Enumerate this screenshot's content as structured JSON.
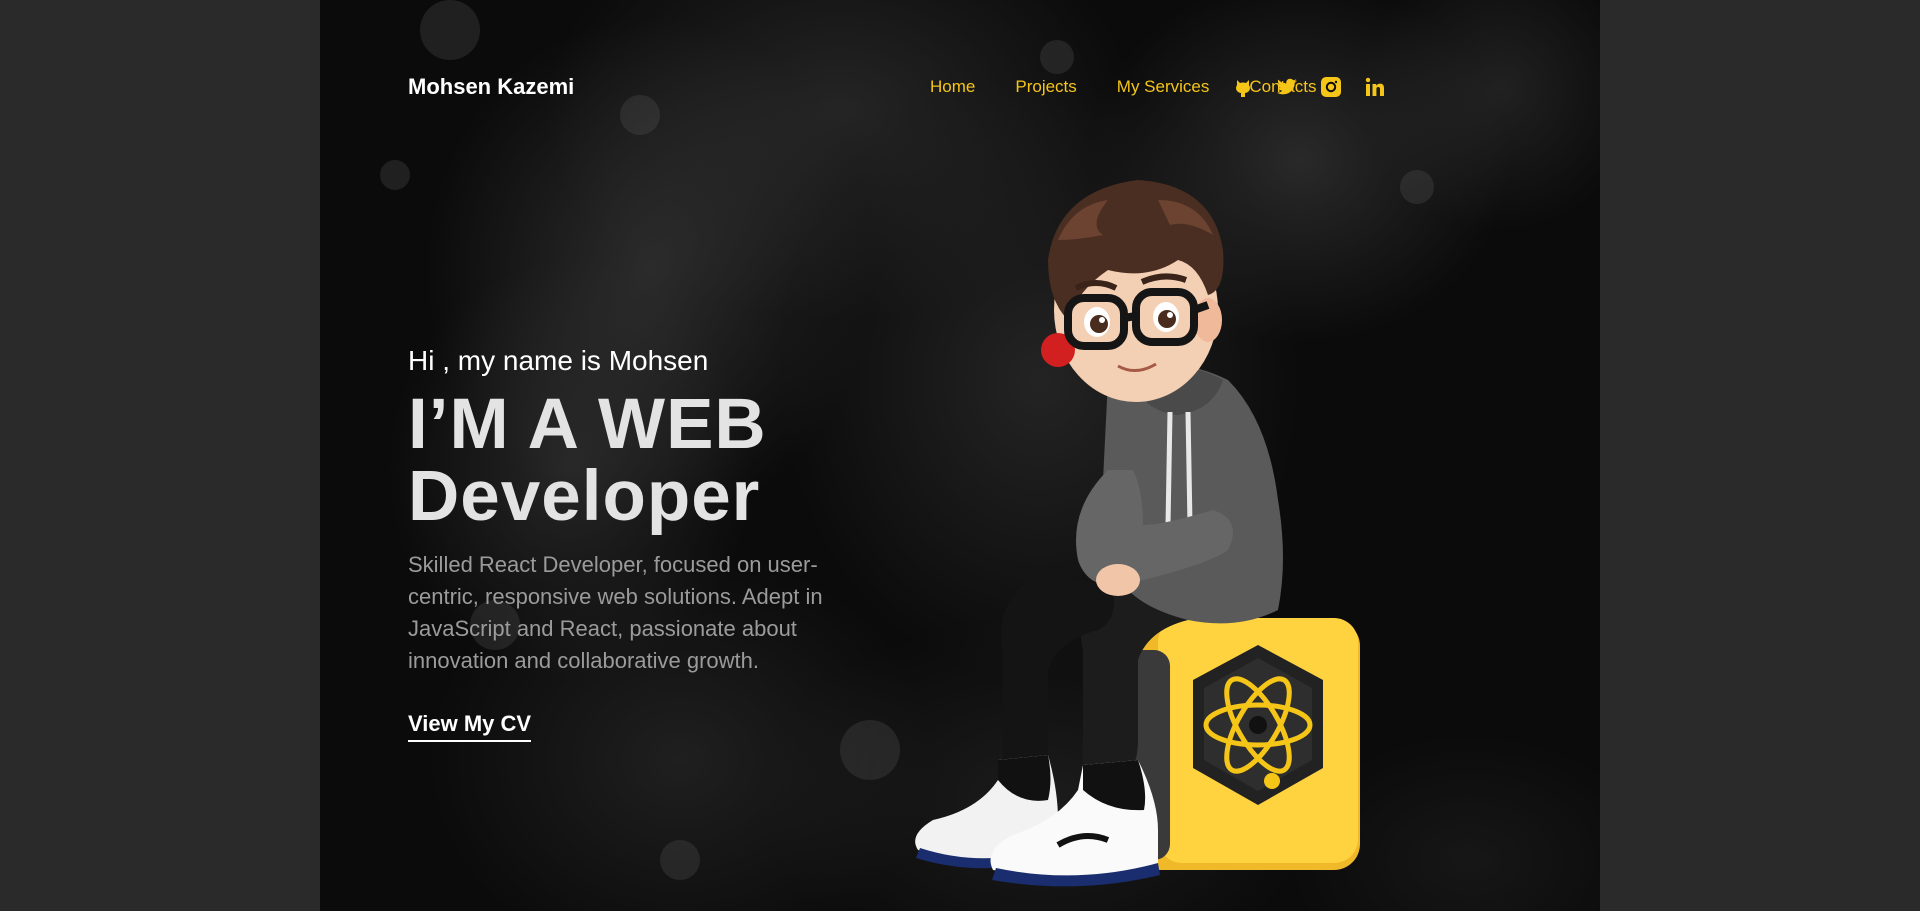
{
  "header": {
    "logo": "Mohsen Kazemi",
    "nav": [
      "Home",
      "Projects",
      "My Services",
      "Contacts"
    ],
    "socials": [
      "github-icon",
      "twitter-icon",
      "instagram-icon",
      "linkedin-icon"
    ]
  },
  "hero": {
    "greeting": "Hi , my name is Mohsen",
    "headline_line1": "I’M A WEB",
    "headline_line2": "Developer",
    "description": "Skilled React Developer, focused on user-centric, responsive web solutions. Adept in JavaScript and React, passionate about innovation and collaborative growth.",
    "cta": "View My CV"
  },
  "colors": {
    "accent": "#f5c518",
    "background": "#0b0b0b",
    "page_outer": "#2a2a2a",
    "text_primary": "#ffffff",
    "text_secondary": "#9b9b9b"
  }
}
